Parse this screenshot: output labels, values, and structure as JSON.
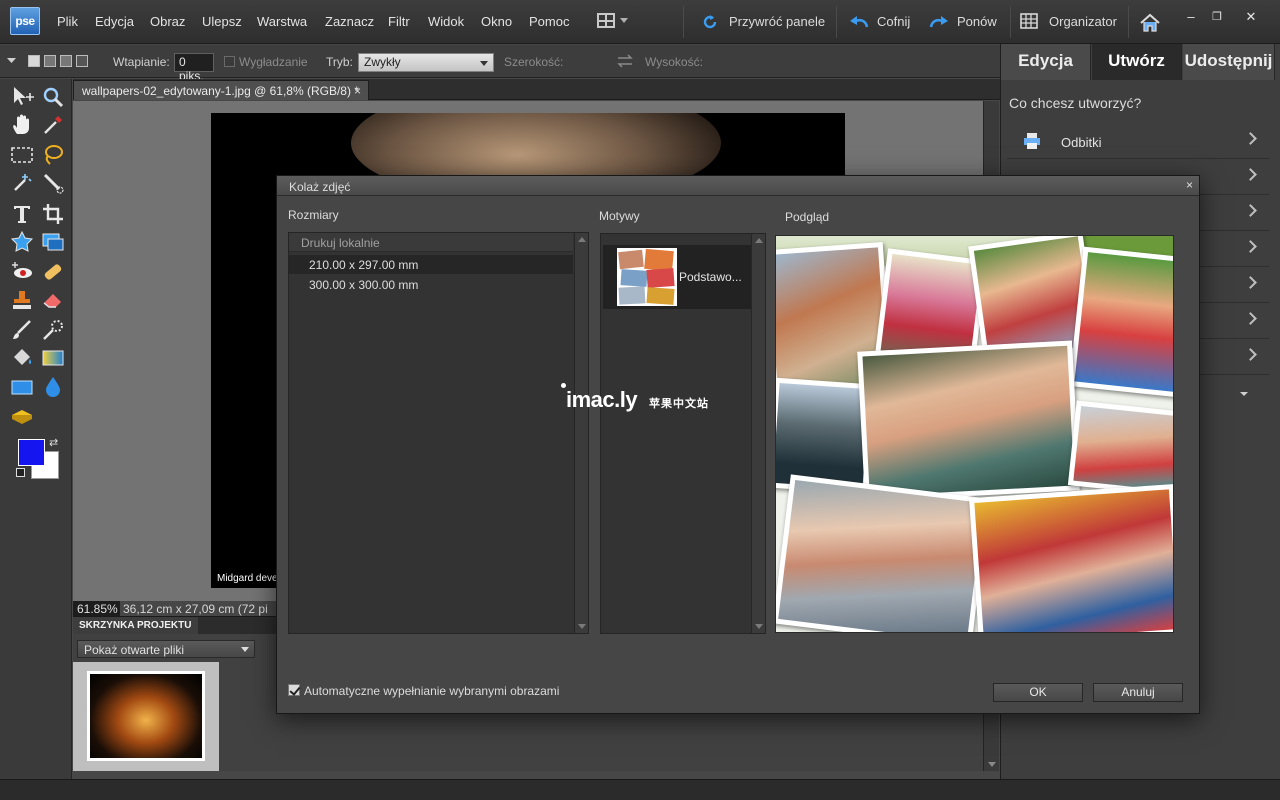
{
  "app": {
    "logo_text": "pse"
  },
  "menu": {
    "items": [
      "Plik",
      "Edycja",
      "Obraz",
      "Ulepsz",
      "Warstwa",
      "Zaznacz",
      "Filtr",
      "Widok",
      "Okno",
      "Pomoc"
    ]
  },
  "toolbar": {
    "reset_panels_label": "Przywróć panele",
    "undo_label": "Cofnij",
    "redo_label": "Ponów",
    "organizer_label": "Organizator",
    "window_minimize": "–",
    "window_restore": "❐",
    "window_close": "✕"
  },
  "options": {
    "feather_label": "Wtapianie:",
    "feather_value": "0 piks.",
    "smooth_label": "Wygładzanie",
    "mode_label": "Tryb:",
    "mode_value": "Zwykły",
    "width_label": "Szerokość:",
    "height_label": "Wysokość:"
  },
  "document": {
    "tab_title": "wallpapers-02_edytowany-1.jpg @ 61,8% (RGB/8) *",
    "tab_close": "×",
    "canvas_credit": "Midgard develo",
    "zoom": "61.85%",
    "size_info": "36,12 cm x 27,09 cm (72 pi"
  },
  "project_bin": {
    "tab_label": "SKRZYNKA PROJEKTU",
    "show_select": "Pokaż otwarte pliki"
  },
  "colors": {
    "foreground": "#1515f0",
    "background": "#ffffff",
    "accent": "#2162b5"
  },
  "panel": {
    "tabs": [
      "Edycja",
      "Utwórz",
      "Udostępnij"
    ],
    "active_tab": "Utwórz",
    "question": "Co chcesz utworzyć?",
    "first_item": "Odbitki",
    "first_item_icon": "printer-icon"
  },
  "dialog": {
    "title": "Kolaż zdjęć",
    "close": "×",
    "sizes_label": "Rozmiary",
    "sizes_group": "Drukuj lokalnie",
    "sizes": [
      "210.00 x 297.00 mm",
      "300.00 x 300.00 mm"
    ],
    "selected_size": "210.00 x 297.00 mm",
    "themes_label": "Motywy",
    "theme_name": "Podstawo...",
    "preview_label": "Podgląd",
    "auto_fill_label": "Automatyczne wypełnianie wybranymi obrazami",
    "auto_fill_checked": true,
    "ok_label": "OK",
    "cancel_label": "Anuluj"
  },
  "watermark": {
    "brand": "imac.ly",
    "subtitle": "苹果中文站"
  }
}
